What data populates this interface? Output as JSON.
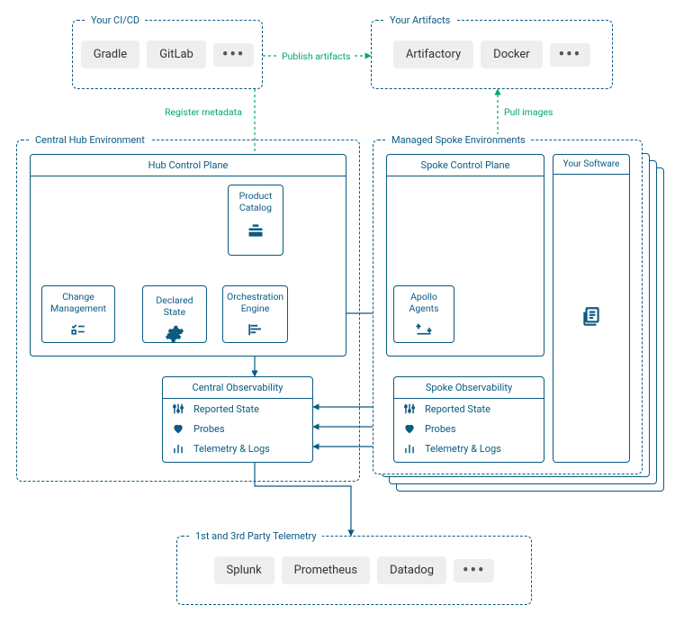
{
  "groups": {
    "cicd": {
      "title": "Your CI/CD",
      "chips": [
        "Gradle",
        "GitLab"
      ]
    },
    "artifacts": {
      "title": "Your Artifacts",
      "chips": [
        "Artifactory",
        "Docker"
      ]
    },
    "hub_env": {
      "title": "Central Hub Environment"
    },
    "spoke_env": {
      "title": "Managed Spoke Environments"
    },
    "telemetry": {
      "title": "1st and 3rd Party Telemetry",
      "chips": [
        "Splunk",
        "Prometheus",
        "Datadog"
      ]
    }
  },
  "panels": {
    "hub_cp": {
      "title": "Hub Control Plane"
    },
    "spoke_cp": {
      "title": "Spoke Control Plane"
    },
    "your_software": {
      "title": "Your Software"
    }
  },
  "nodes": {
    "product_catalog": "Product Catalog",
    "change_mgmt": "Change Management",
    "declared_state": "Declared State",
    "orchestration": "Orchestration Engine",
    "apollo_agents": "Apollo Agents"
  },
  "observability": {
    "central": {
      "title": "Central Observability"
    },
    "spoke": {
      "title": "Spoke Observability"
    },
    "rows": {
      "reported_state": "Reported State",
      "probes": "Probes",
      "telemetry_logs": "Telemetry & Logs"
    }
  },
  "edges": {
    "publish_artifacts": "Publish artifacts",
    "register_metadata": "Register metadata",
    "pull_images": "Pull images"
  },
  "misc": {
    "ellipsis": "•••"
  }
}
